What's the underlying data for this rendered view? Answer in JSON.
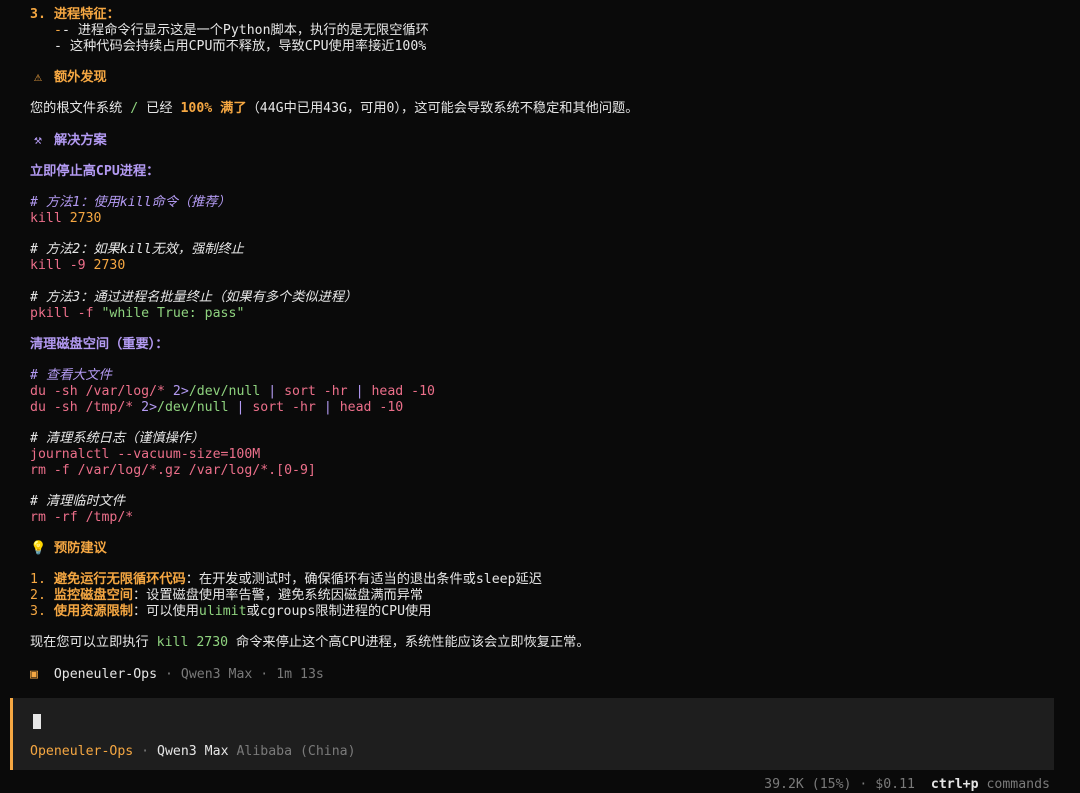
{
  "s3": {
    "title": "3. 进程特征：",
    "b1": "- 进程命令行显示这是一个Python脚本，执行的是无限空循环",
    "b2": "- 这种代码会持续占用CPU而不释放，导致CPU使用率接近100%"
  },
  "extra": {
    "heading": "额外发现",
    "pre": "您的根文件系统 ",
    "slash": "/",
    "mid": " 已经 ",
    "pct": "100% 满了",
    "post": "（44G中已用43G，可用0），这可能会导致系统不稳定和其他问题。"
  },
  "solution": {
    "heading": "解决方案",
    "stop_title": "立即停止高CPU进程：",
    "m1_comment": "# 方法1：使用kill命令（推荐）",
    "m1_cmd": "kill",
    "m1_arg": "2730",
    "m2_comment": "# 方法2：如果kill无效，强制终止",
    "m2_cmd": "kill -9",
    "m2_arg": "2730",
    "m3_comment": "# 方法3：通过进程名批量终止（如果有多个类似进程）",
    "m3_cmd": "pkill -f ",
    "m3_arg": "\"while True: pass\"",
    "disk_title": "清理磁盘空间（重要）：",
    "view_comment": "# 查看大文件",
    "du1_a": "du -sh /var/log/* ",
    "du1_b": "2>",
    "du1_c": "/dev/null",
    "du1_d": " | ",
    "du1_e": "sort -hr",
    "du1_f": " | ",
    "du1_g": "head -10",
    "du2_a": "du -sh /tmp/* ",
    "du2_b": "2>",
    "du2_c": "/dev/null",
    "du2_d": " | ",
    "du2_e": "sort -hr",
    "du2_f": " | ",
    "du2_g": "head -10",
    "log_comment": "# 清理系统日志（谨慎操作）",
    "journal": "journalctl --vacuum-size=100M",
    "rmlog": "rm -f /var/log/*.gz /var/log/*.[0-9]",
    "tmp_comment": "# 清理临时文件",
    "rmtmp": "rm -rf /tmp/*"
  },
  "prevent": {
    "heading": "预防建议",
    "i1_num": "1. ",
    "i1_title": "避免运行无限循环代码",
    "i1_text": "：在开发或测试时，确保循环有适当的退出条件或sleep延迟",
    "i2_num": "2. ",
    "i2_title": "监控磁盘空间",
    "i2_text": "：设置磁盘使用率告警，避免系统因磁盘满而异常",
    "i3_num": "3. ",
    "i3_title": "使用资源限制",
    "i3_text_a": "：可以使用",
    "i3_code": "ulimit",
    "i3_text_b": "或cgroups限制进程的CPU使用"
  },
  "final": {
    "pre": "现在您可以立即执行 ",
    "code": "kill 2730",
    "post": " 命令来停止这个高CPU进程，系统性能应该会立即恢复正常。"
  },
  "agent_line": {
    "bullet": "▣",
    "agent": "Openeuler-Ops",
    "sep1": " · ",
    "model": "Qwen3 Max",
    "sep2": " · ",
    "time": "1m 13s"
  },
  "prompt_box": {
    "agent": "Openeuler-Ops",
    "sep": " · ",
    "model": "Qwen3 Max",
    "provider": "Alibaba (China)"
  },
  "status_bar": {
    "stats": "39.2K (15%) · $0.11",
    "key": "ctrl+p",
    "label": "commands"
  },
  "icons": {
    "warning": "warning-icon",
    "tools": "tools-icon",
    "bulb": "lightbulb-icon"
  },
  "colors": {
    "accent": "#f5a742",
    "heading_purple": "#b39af2",
    "command_pink": "#ec6f8a",
    "string_green": "#8fd37f",
    "background": "#0a0a0a"
  }
}
